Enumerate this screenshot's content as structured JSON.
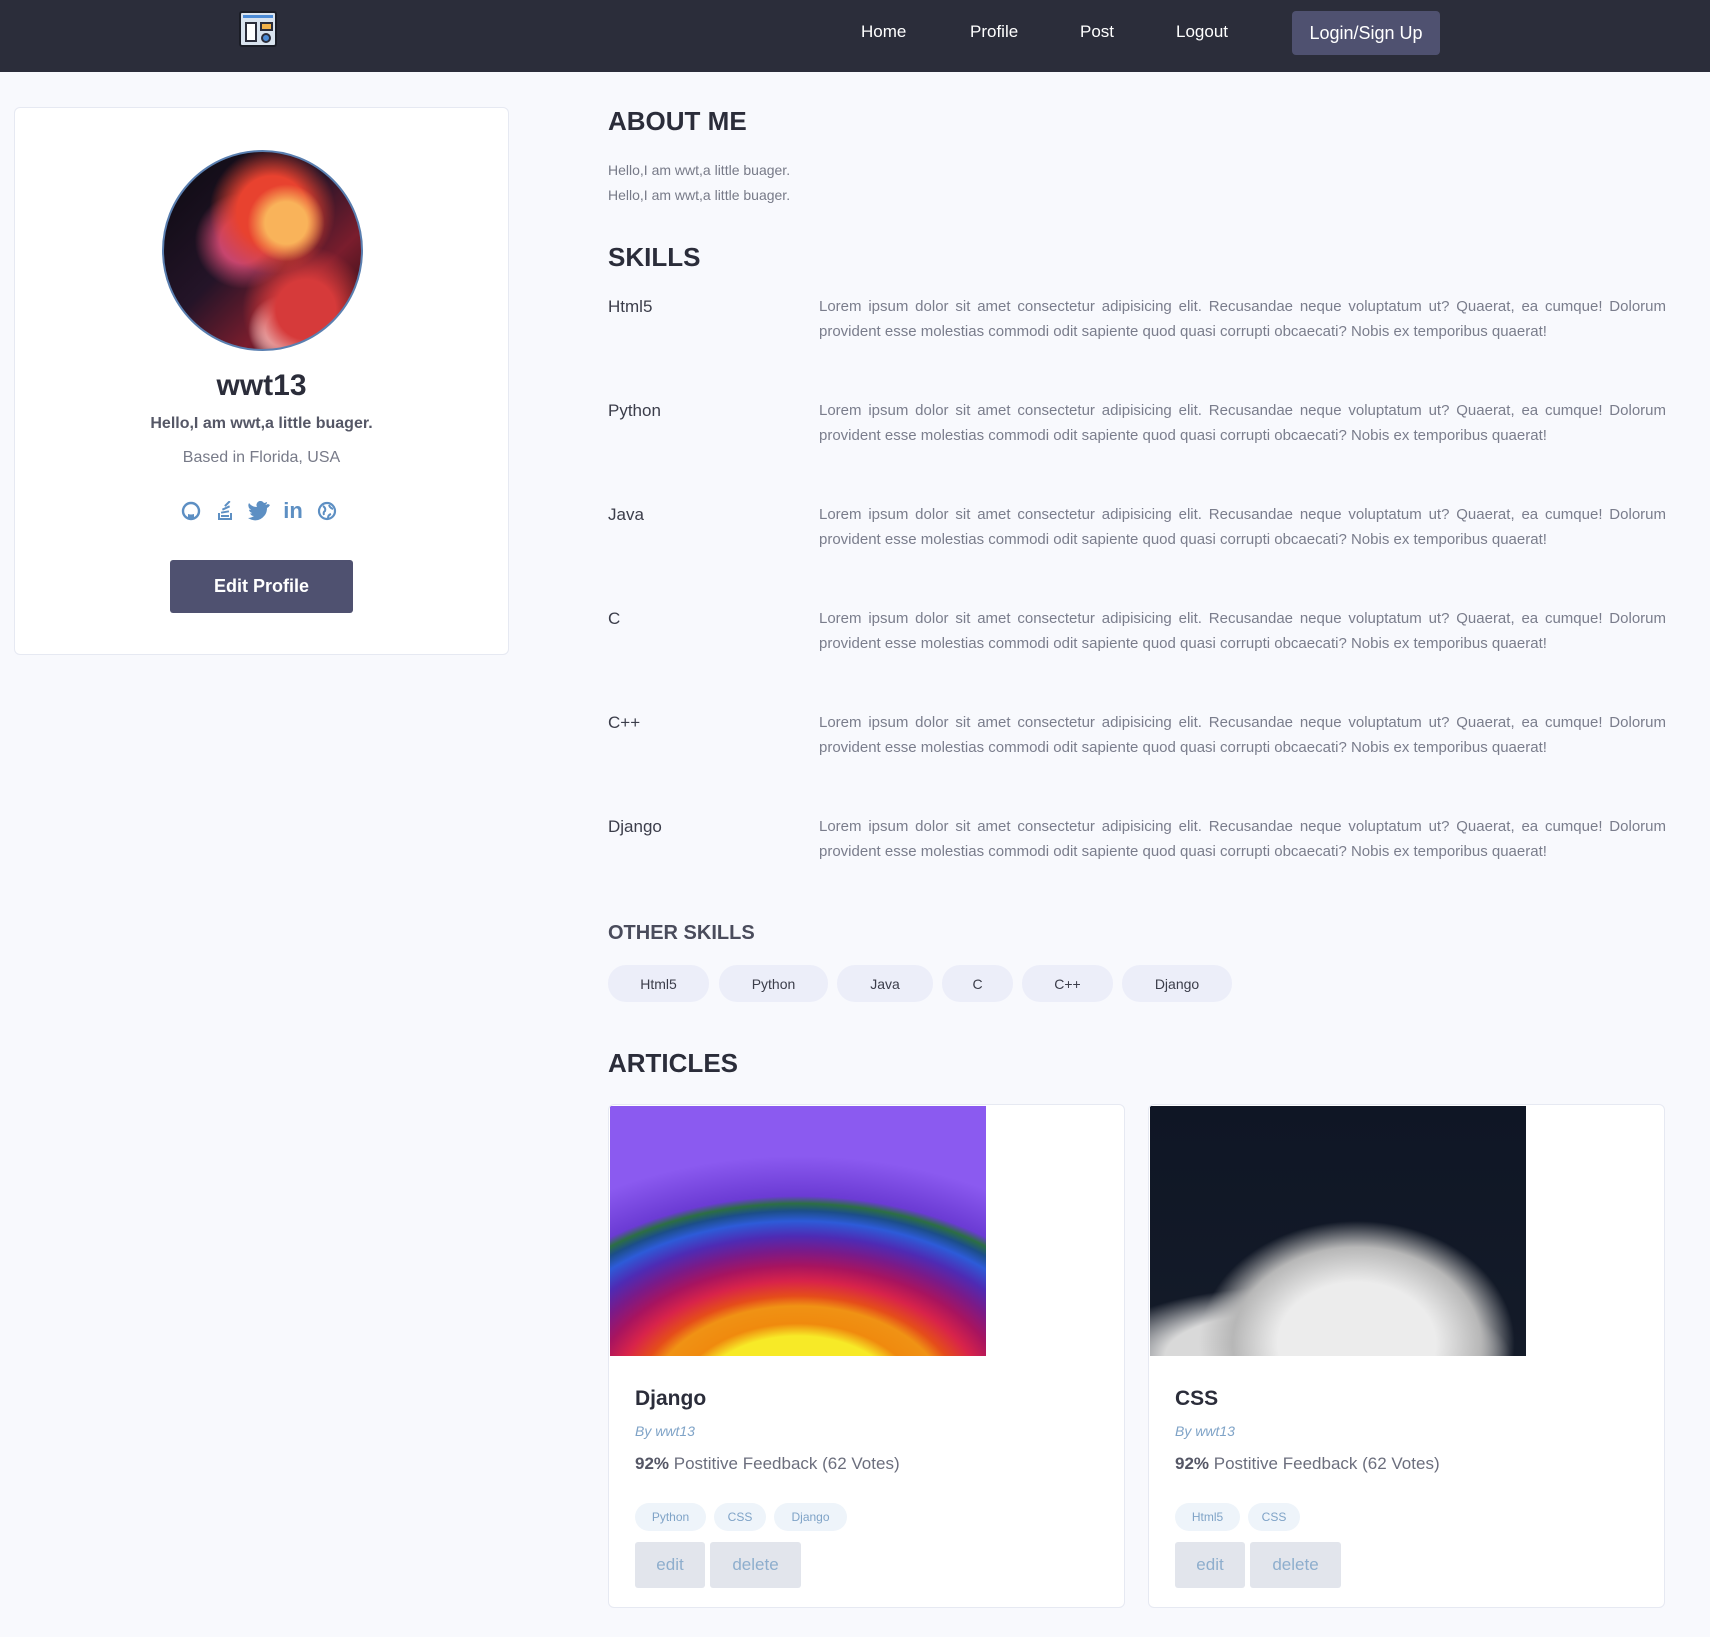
{
  "nav": {
    "items": [
      "Home",
      "Profile",
      "Post",
      "Logout"
    ],
    "login_label": "Login/Sign Up"
  },
  "profile": {
    "username": "wwt13",
    "tagline": "Hello,I am wwt,a little buager.",
    "location": "Based in Florida, USA",
    "socials": [
      "github-icon",
      "stackoverflow-icon",
      "twitter-icon",
      "linkedin-icon",
      "website-icon"
    ],
    "edit_label": "Edit Profile"
  },
  "about": {
    "title": "ABOUT ME",
    "lines": [
      "Hello,I am wwt,a little buager.",
      "Hello,I am wwt,a little buager."
    ]
  },
  "skills": {
    "title": "SKILLS",
    "items": [
      {
        "name": "Html5",
        "description": "Lorem ipsum dolor sit amet consectetur adipisicing elit. Recusandae neque voluptatum ut? Quaerat, ea cumque! Dolorum provident esse molestias commodi odit sapiente quod quasi corrupti obcaecati? Nobis ex temporibus quaerat!"
      },
      {
        "name": "Python",
        "description": "Lorem ipsum dolor sit amet consectetur adipisicing elit. Recusandae neque voluptatum ut? Quaerat, ea cumque! Dolorum provident esse molestias commodi odit sapiente quod quasi corrupti obcaecati? Nobis ex temporibus quaerat!"
      },
      {
        "name": "Java",
        "description": "Lorem ipsum dolor sit amet consectetur adipisicing elit. Recusandae neque voluptatum ut? Quaerat, ea cumque! Dolorum provident esse molestias commodi odit sapiente quod quasi corrupti obcaecati? Nobis ex temporibus quaerat!"
      },
      {
        "name": "C",
        "description": "Lorem ipsum dolor sit amet consectetur adipisicing elit. Recusandae neque voluptatum ut? Quaerat, ea cumque! Dolorum provident esse molestias commodi odit sapiente quod quasi corrupti obcaecati? Nobis ex temporibus quaerat!"
      },
      {
        "name": "C++",
        "description": "Lorem ipsum dolor sit amet consectetur adipisicing elit. Recusandae neque voluptatum ut? Quaerat, ea cumque! Dolorum provident esse molestias commodi odit sapiente quod quasi corrupti obcaecati? Nobis ex temporibus quaerat!"
      },
      {
        "name": "Django",
        "description": "Lorem ipsum dolor sit amet consectetur adipisicing elit. Recusandae neque voluptatum ut? Quaerat, ea cumque! Dolorum provident esse molestias commodi odit sapiente quod quasi corrupti obcaecati? Nobis ex temporibus quaerat!"
      }
    ]
  },
  "other_skills": {
    "title": "OTHER SKILLS",
    "items": [
      "Html5",
      "Python",
      "Java",
      "C",
      "C++",
      "Django"
    ]
  },
  "articles": {
    "title": "ARTICLES",
    "items": [
      {
        "title": "Django",
        "author": "By wwt13",
        "percent": "92%",
        "feedback": "Postitive Feedback (62 Votes)",
        "tags": [
          "Python",
          "CSS",
          "Django"
        ],
        "edit": "edit",
        "delete": "delete"
      },
      {
        "title": "CSS",
        "author": "By wwt13",
        "percent": "92%",
        "feedback": "Postitive Feedback (62 Votes)",
        "tags": [
          "Html5",
          "CSS"
        ],
        "edit": "edit",
        "delete": "delete"
      }
    ]
  },
  "colors": {
    "header_bg": "#2b2d3a",
    "accent": "#4f5170",
    "page_bg": "#f8f9fd",
    "link_blue": "#7fa3c7"
  }
}
